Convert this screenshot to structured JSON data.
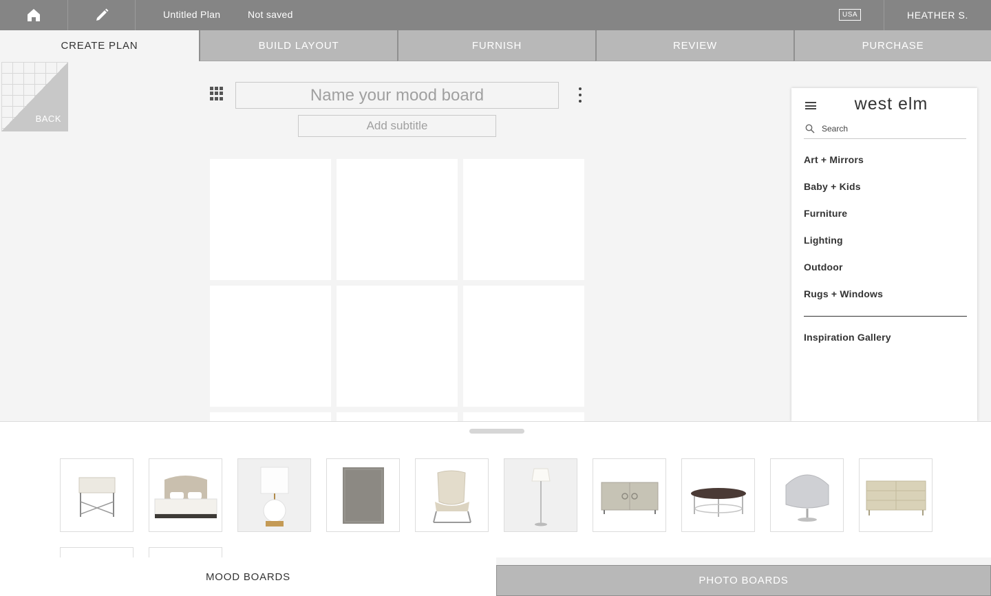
{
  "topbar": {
    "plan_name": "Untitled Plan",
    "save_status": "Not saved",
    "region": "USA",
    "user_name": "HEATHER S."
  },
  "steps": [
    {
      "label": "CREATE PLAN",
      "active": true
    },
    {
      "label": "BUILD LAYOUT",
      "active": false
    },
    {
      "label": "FURNISH",
      "active": false
    },
    {
      "label": "REVIEW",
      "active": false
    },
    {
      "label": "PURCHASE",
      "active": false
    }
  ],
  "back_label": "BACK",
  "board": {
    "title_placeholder": "Name your mood board",
    "subtitle_placeholder": "Add subtitle"
  },
  "store": {
    "logo": "west elm",
    "search_placeholder": "Search",
    "categories": [
      "Art + Mirrors",
      "Baby + Kids",
      "Furniture",
      "Lighting",
      "Outdoor",
      "Rugs + Windows"
    ],
    "gallery_link": "Inspiration Gallery"
  },
  "products": [
    {
      "icon": "side-table"
    },
    {
      "icon": "bed"
    },
    {
      "icon": "table-lamp"
    },
    {
      "icon": "rug"
    },
    {
      "icon": "lounge-chair"
    },
    {
      "icon": "floor-lamp"
    },
    {
      "icon": "sideboard"
    },
    {
      "icon": "coffee-table"
    },
    {
      "icon": "swivel-chair"
    },
    {
      "icon": "dresser"
    }
  ],
  "bottom_tabs": {
    "mood_boards": "MOOD BOARDS",
    "photo_boards": "PHOTO BOARDS"
  }
}
